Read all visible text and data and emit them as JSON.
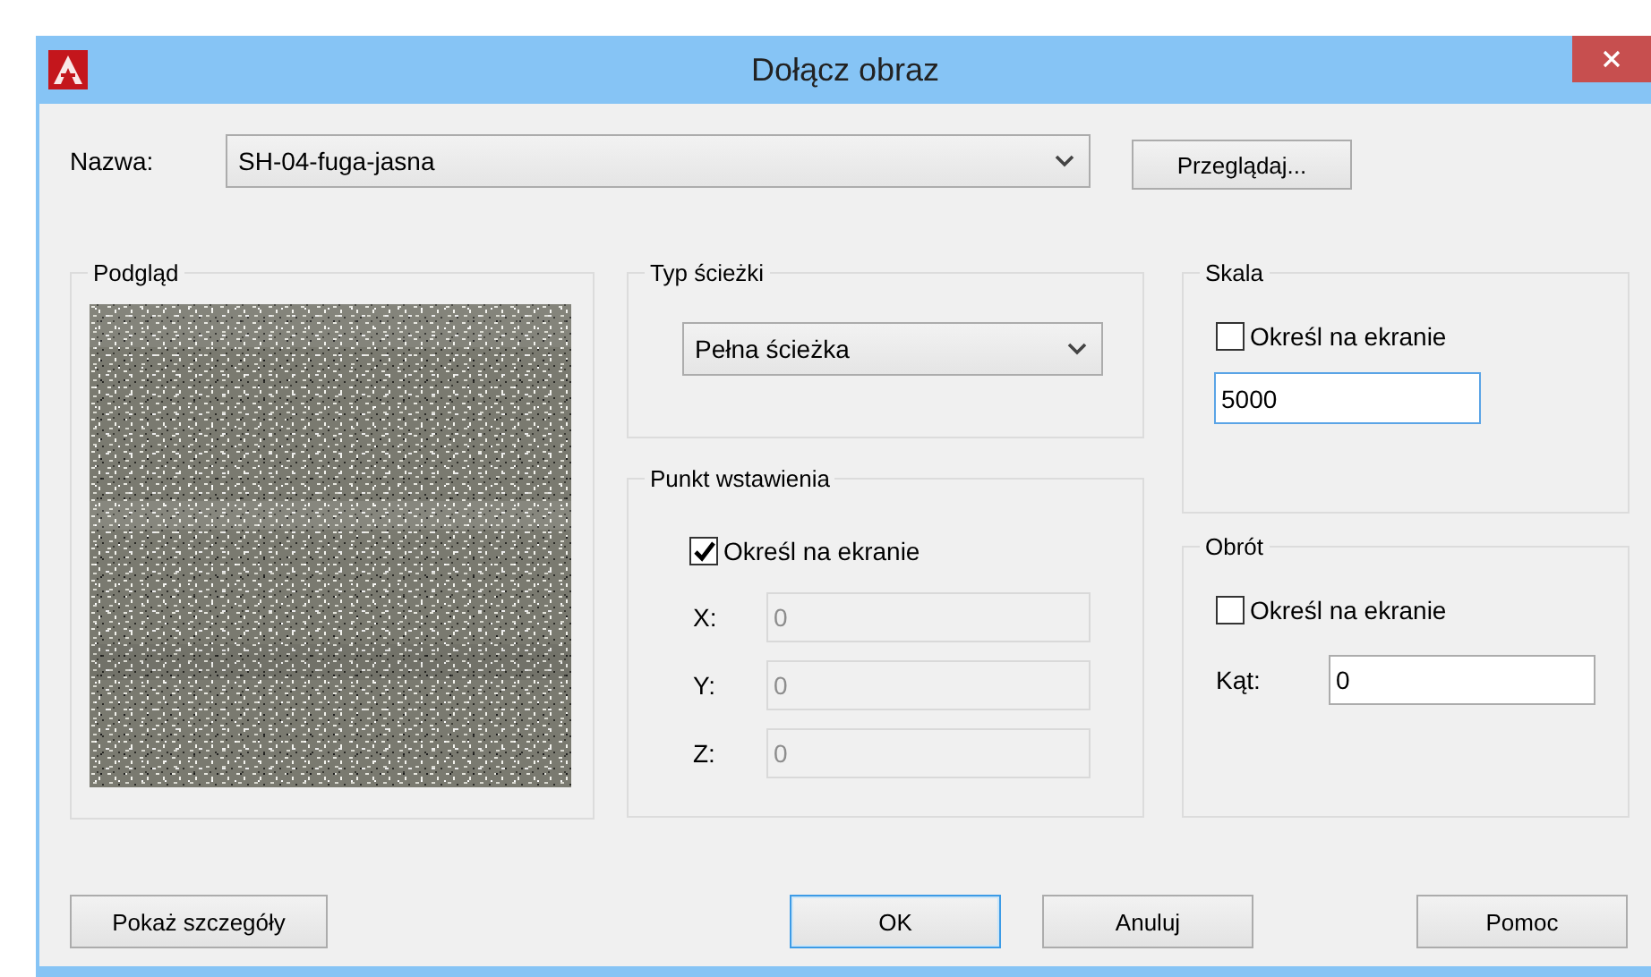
{
  "window": {
    "title": "Dołącz obraz"
  },
  "name_field": {
    "label": "Nazwa:",
    "value": "SH-04-fuga-jasna"
  },
  "browse_button": {
    "label": "Przeglądaj..."
  },
  "preview": {
    "title": "Podgląd"
  },
  "path_type": {
    "title": "Typ ścieżki",
    "value": "Pełna ścieżka"
  },
  "insertion_point": {
    "title": "Punkt wstawienia",
    "specify_on_screen": {
      "label": "Określ na ekranie",
      "checked": true
    },
    "coordinates": [
      {
        "label": "X:",
        "value": "0",
        "disabled": true
      },
      {
        "label": "Y:",
        "value": "0",
        "disabled": true
      },
      {
        "label": "Z:",
        "value": "0",
        "disabled": true
      }
    ]
  },
  "scale": {
    "title": "Skala",
    "specify_on_screen": {
      "label": "Określ na ekranie",
      "checked": false
    },
    "value": "5000",
    "focused": true
  },
  "rotation": {
    "title": "Obrót",
    "specify_on_screen": {
      "label": "Określ na ekranie",
      "checked": false
    },
    "angle": {
      "label": "Kąt:",
      "value": "0",
      "disabled": false
    }
  },
  "buttons": [
    {
      "label": "Pokaż szczegóły",
      "default": false
    },
    {
      "label": "OK",
      "default": true
    },
    {
      "label": "Anuluj",
      "default": false
    },
    {
      "label": "Pomoc",
      "default": false
    }
  ]
}
